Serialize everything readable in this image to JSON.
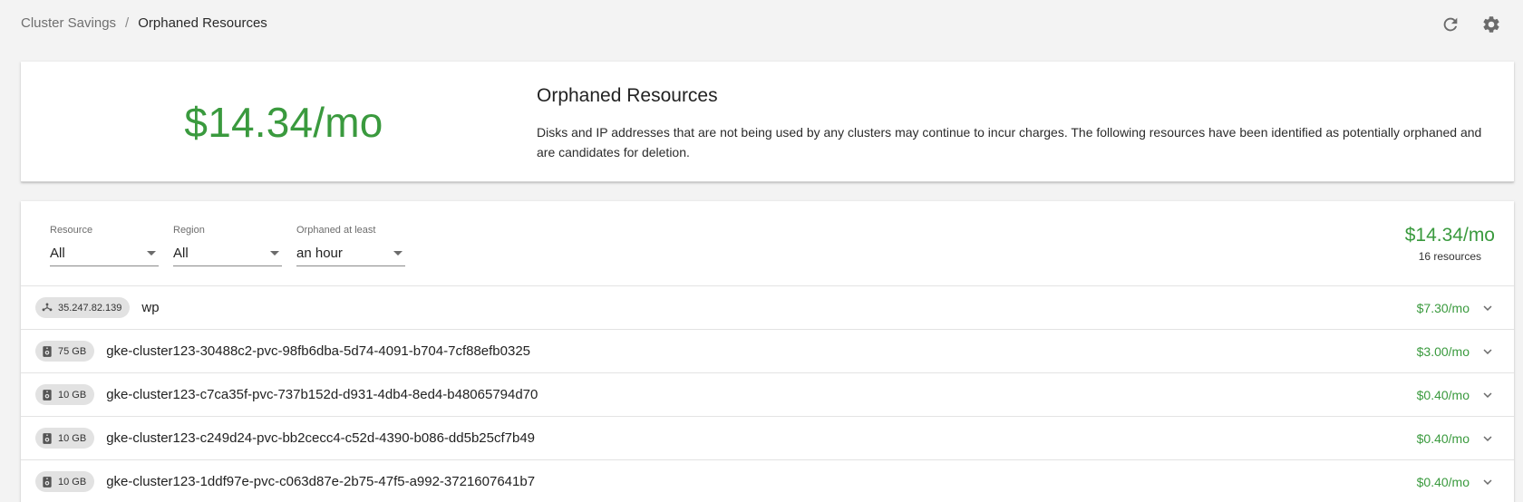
{
  "breadcrumb": {
    "parent": "Cluster Savings",
    "separator": "/",
    "current": "Orphaned Resources"
  },
  "icons": {
    "refresh": "refresh-icon",
    "settings": "gear-icon"
  },
  "summary": {
    "total": "$14.34/mo",
    "title": "Orphaned Resources",
    "description": "Disks and IP addresses that are not being used by any clusters may continue to incur charges. The following resources have been identified as potentially orphaned and are candidates for deletion."
  },
  "filters": {
    "resource": {
      "label": "Resource",
      "value": "All"
    },
    "region": {
      "label": "Region",
      "value": "All"
    },
    "orphaned": {
      "label": "Orphaned at least",
      "value": "an hour"
    },
    "total": "$14.34/mo",
    "count": "16 resources"
  },
  "colors": {
    "accent_green": "#3a9a3e",
    "chip_bg": "#e2e2e2"
  },
  "rows": [
    {
      "type": "ip",
      "icon": "network-icon",
      "chip": "35.247.82.139",
      "name": "wp",
      "cost": "$7.30/mo"
    },
    {
      "type": "disk",
      "icon": "disk-icon",
      "chip": "75 GB",
      "name": "gke-cluster123-30488c2-pvc-98fb6dba-5d74-4091-b704-7cf88efb0325",
      "cost": "$3.00/mo"
    },
    {
      "type": "disk",
      "icon": "disk-icon",
      "chip": "10 GB",
      "name": "gke-cluster123-c7ca35f-pvc-737b152d-d931-4db4-8ed4-b48065794d70",
      "cost": "$0.40/mo"
    },
    {
      "type": "disk",
      "icon": "disk-icon",
      "chip": "10 GB",
      "name": "gke-cluster123-c249d24-pvc-bb2cecc4-c52d-4390-b086-dd5b25cf7b49",
      "cost": "$0.40/mo"
    },
    {
      "type": "disk",
      "icon": "disk-icon",
      "chip": "10 GB",
      "name": "gke-cluster123-1ddf97e-pvc-c063d87e-2b75-47f5-a992-3721607641b7",
      "cost": "$0.40/mo"
    }
  ]
}
